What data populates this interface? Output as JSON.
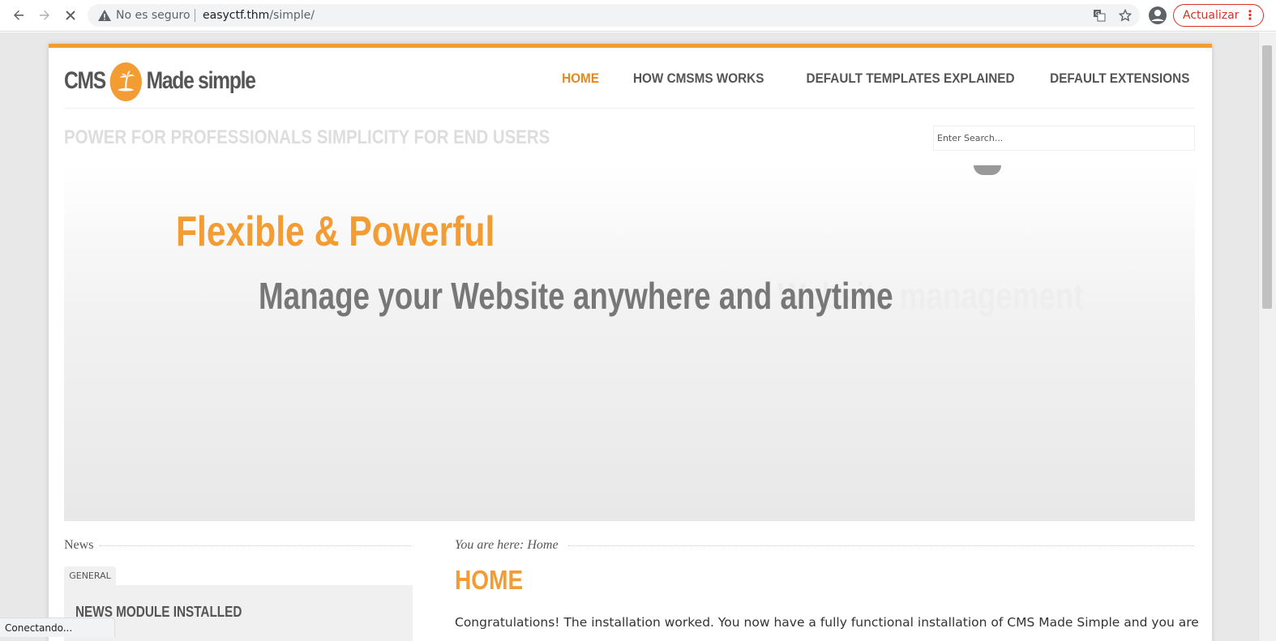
{
  "browser": {
    "security_label": "No es seguro",
    "url_host": "easyctf.thm",
    "url_path": "/simple/",
    "update_label": "Actualizar",
    "status_text": "Conectando..."
  },
  "site": {
    "logo_text_left": "CMS",
    "logo_text_right": "Made simple",
    "nav": [
      {
        "label": "HOME",
        "active": true
      },
      {
        "label": "HOW CMSMS WORKS"
      },
      {
        "label": "DEFAULT TEMPLATES EXPLAINED"
      },
      {
        "label": "DEFAULT EXTENSIONS"
      }
    ],
    "slogan": "POWER FOR PROFESSIONALS SIMPLICITY FOR END USERS",
    "search_placeholder": "Enter Search...",
    "banner": {
      "title": "Flexible & Powerful",
      "subtitle": "Manage your Website anywhere and anytime",
      "ghost_text": "Website management"
    },
    "sidebar": {
      "heading": "News",
      "tab_label": "GENERAL",
      "item_title": "NEWS MODULE INSTALLED"
    },
    "main": {
      "breadcrumb": "You are here: Home",
      "title": "HOME",
      "intro": "Congratulations! The installation worked. You now have a fully functional installation of CMS Made Simple and you are"
    }
  },
  "colors": {
    "accent": "#f39c34",
    "text": "#555555",
    "update_red": "#d93025"
  }
}
